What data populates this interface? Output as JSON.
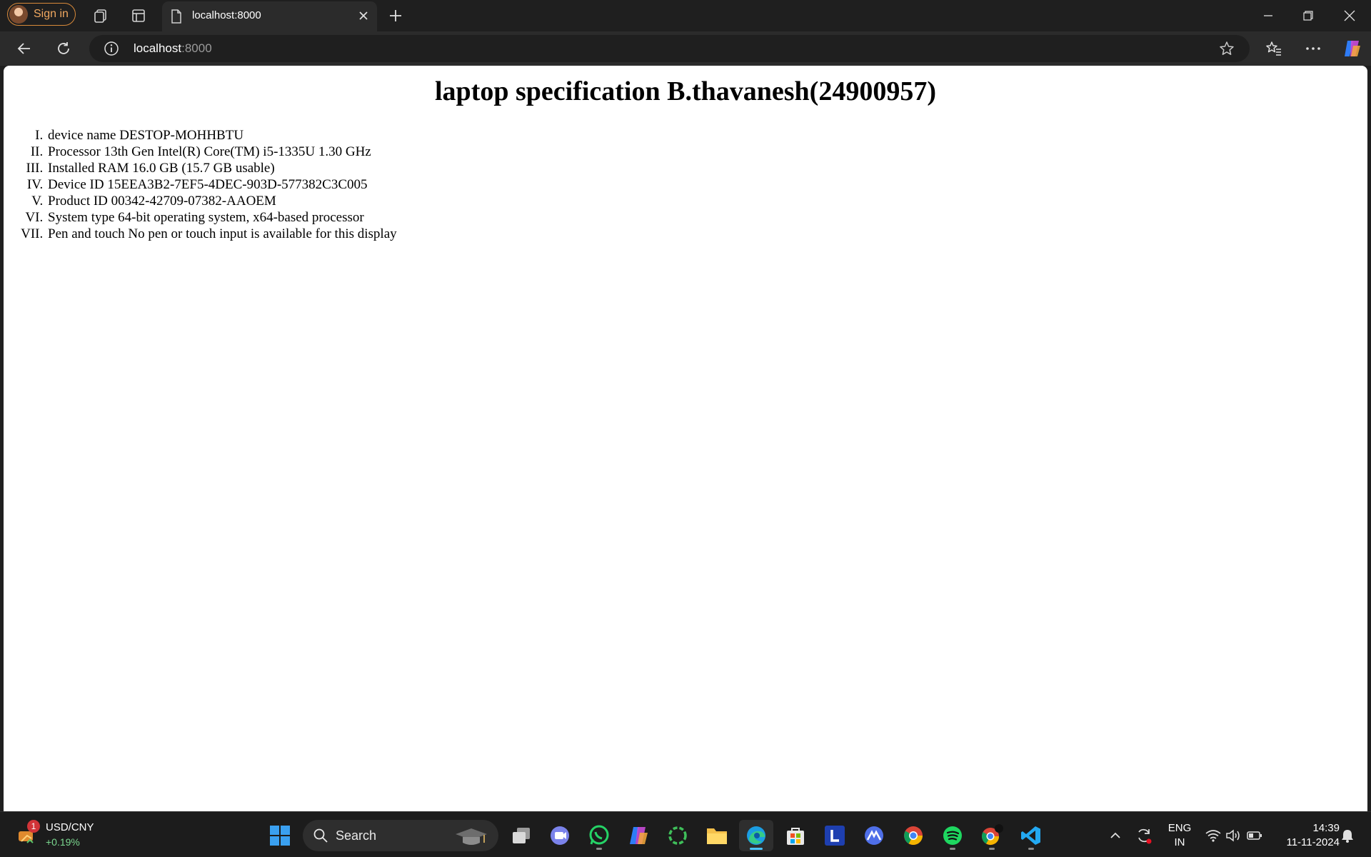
{
  "browser": {
    "sign_in_label": "Sign in",
    "tab_title": "localhost:8000",
    "url_host": "localhost",
    "url_port": ":8000"
  },
  "page": {
    "heading": "laptop specification B.thavanesh(24900957)",
    "specs": [
      "device name DESTOP-MOHHBTU",
      "Processor 13th Gen Intel(R) Core(TM) i5-1335U 1.30 GHz",
      "Installed RAM 16.0 GB (15.7 GB usable)",
      "Device ID 15EEA3B2-7EF5-4DEC-903D-577382C3C005",
      "Product ID 00342-42709-07382-AAOEM",
      "System type 64-bit operating system, x64-based processor",
      "Pen and touch No pen or touch input is available for this display"
    ]
  },
  "taskbar": {
    "widget_pair": "USD/CNY",
    "widget_change": "+0.19%",
    "widget_badge": "1",
    "search_label": "Search",
    "lang_1": "ENG",
    "lang_2": "IN",
    "time": "14:39",
    "date": "11-11-2024"
  },
  "colors": {
    "accent_blue": "#4cc2ff",
    "signin_orange": "#f0a860",
    "positive_green": "#7bd88f"
  }
}
